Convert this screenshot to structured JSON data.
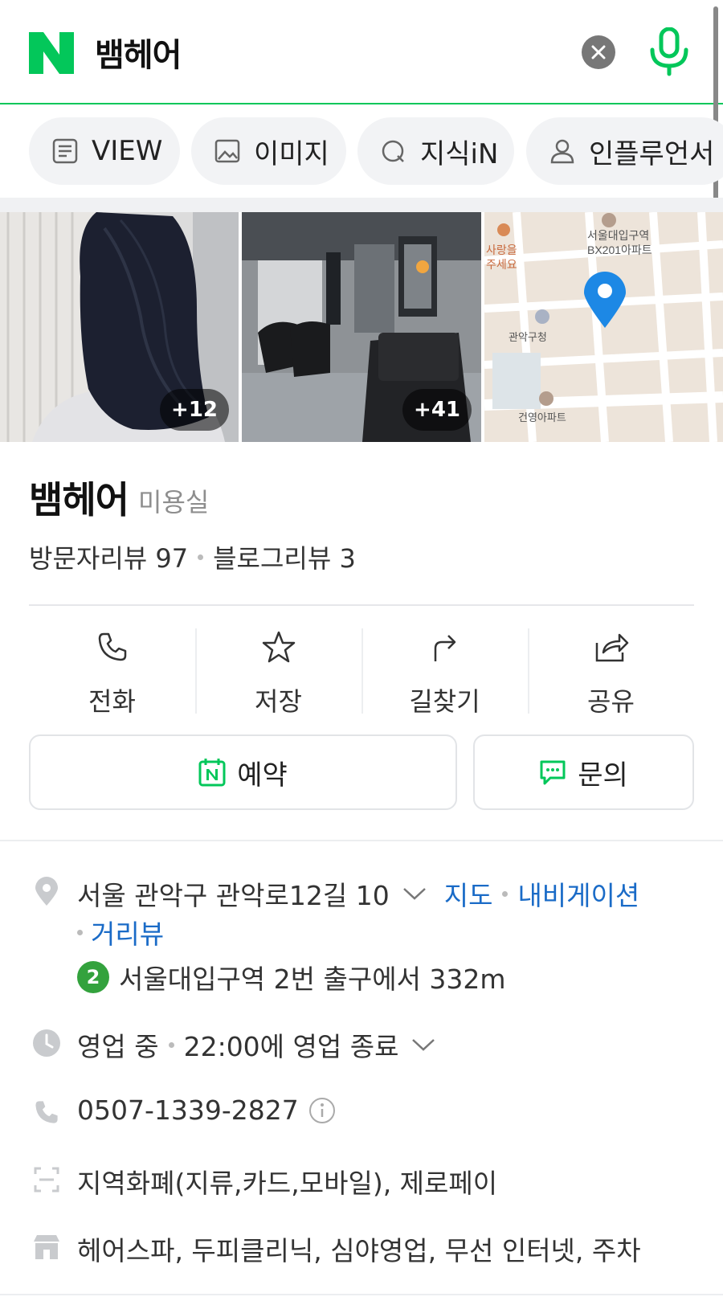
{
  "search": {
    "query": "뱀헤어"
  },
  "tabs": [
    {
      "label": "VIEW",
      "icon": "document-icon"
    },
    {
      "label": "이미지",
      "icon": "image-icon"
    },
    {
      "label": "지식iN",
      "icon": "q-icon"
    },
    {
      "label": "인플루언서",
      "icon": "person-icon"
    }
  ],
  "photos": [
    {
      "badge": "+12"
    },
    {
      "badge": "+41"
    }
  ],
  "map_labels": {
    "station": "서울대입구역",
    "apartment1": "BX201아파트",
    "office": "관악구청",
    "apartment2": "건영아파트",
    "partial1": "사랑을",
    "partial2": "주세요"
  },
  "place": {
    "name": "뱀헤어",
    "category": "미용실",
    "visitor_reviews": "방문자리뷰 97",
    "blog_reviews": "블로그리뷰 3"
  },
  "actions": [
    {
      "label": "전화",
      "icon": "phone-icon"
    },
    {
      "label": "저장",
      "icon": "star-icon"
    },
    {
      "label": "길찾기",
      "icon": "directions-icon"
    },
    {
      "label": "공유",
      "icon": "share-icon"
    }
  ],
  "buttons": {
    "reserve": "예약",
    "inquiry": "문의"
  },
  "details": {
    "address": "서울 관악구 관악로12길 10",
    "map_link": "지도",
    "navi_link": "내비게이션",
    "street_link": "거리뷰",
    "subway_line": "2",
    "subway_text": "서울대입구역 2번 출구에서 332m",
    "status": "영업 중",
    "hours": "22:00에 영업 종료",
    "phone": "0507-1339-2827",
    "payment": "지역화폐(지류,카드,모바일), 제로페이",
    "amenities": "헤어스파, 두피클리닉, 심야영업, 무선 인터넷, 주차"
  },
  "colors": {
    "brand": "#03c75a",
    "link": "#1a6bc7",
    "pin": "#1d88e5",
    "subway_line2": "#33a23d"
  }
}
